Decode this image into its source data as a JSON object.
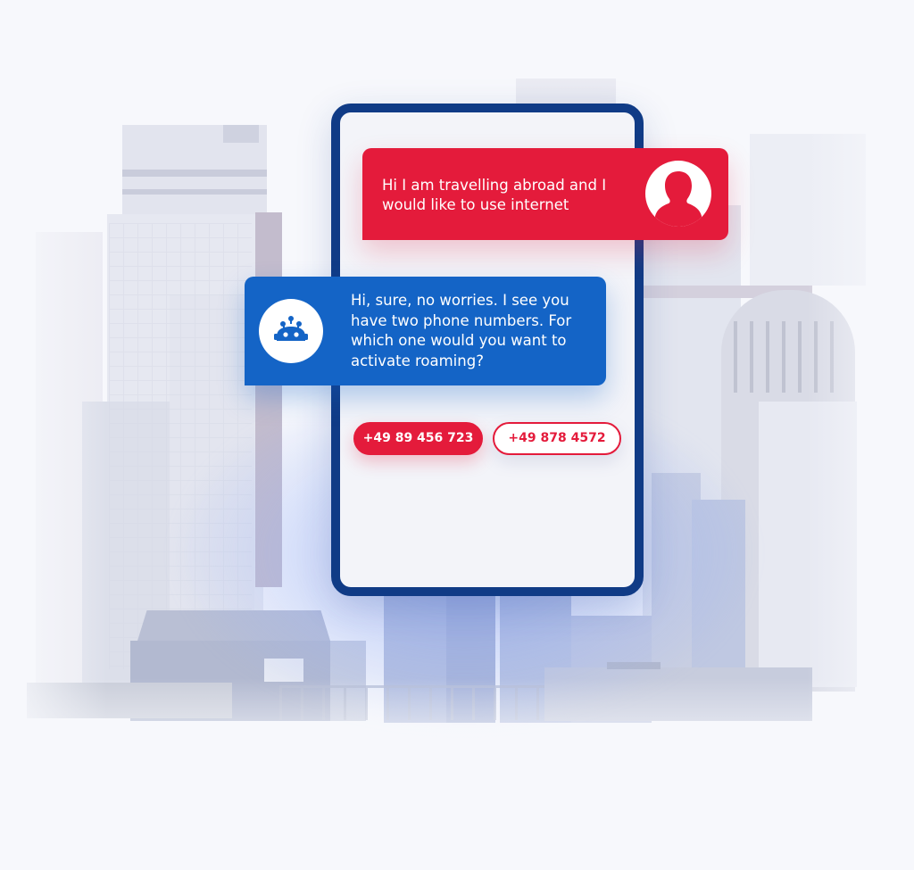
{
  "chat": {
    "user_message": "Hi I am travelling abroad and I would like to use internet",
    "bot_message": "Hi, sure, no worries. I see you have two phone numbers. For which one would you want to activate roaming?",
    "options": [
      {
        "label": "+49 89 456 723",
        "style": "filled"
      },
      {
        "label": "+49 878 4572",
        "style": "outlined"
      }
    ]
  },
  "icons": {
    "user_avatar": "user-silhouette-icon",
    "bot_avatar": "robot-icon"
  },
  "colors": {
    "brand_red": "#e41b3b",
    "brand_blue": "#1464c6",
    "phone_frame": "#103b86",
    "background": "#f7f8fc"
  }
}
